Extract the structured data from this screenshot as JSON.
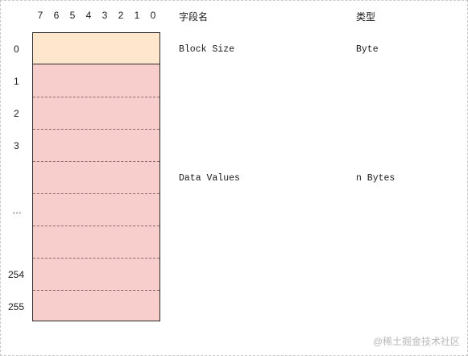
{
  "bit_labels": [
    "7",
    "6",
    "5",
    "4",
    "3",
    "2",
    "1",
    "0"
  ],
  "row_labels": {
    "r0": "0",
    "r1": "1",
    "r2": "2",
    "r3": "3",
    "ellipsis": "…",
    "r254": "254",
    "r255": "255"
  },
  "columns": {
    "field_name": "字段名",
    "type": "类型"
  },
  "fields": [
    {
      "name": "Block Size",
      "type": "Byte"
    },
    {
      "name": "Data Values",
      "type": "n Bytes"
    }
  ],
  "watermark": "@稀土掘金技术社区",
  "colors": {
    "header_fill": "#ffe6cc",
    "data_fill": "#f8cecc",
    "border": "#2b2b2b"
  }
}
